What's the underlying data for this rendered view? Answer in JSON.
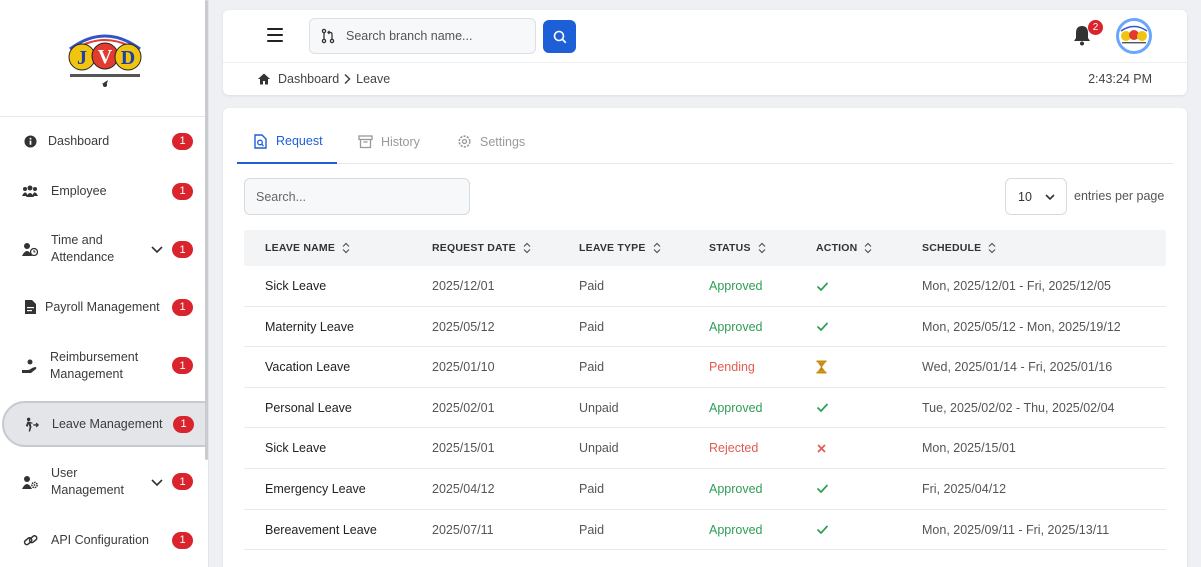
{
  "sidebar": {
    "logo_text": "JVD",
    "items": [
      {
        "label": "Dashboard",
        "badge": "1",
        "icon": "info-circle-icon"
      },
      {
        "label": "Employee",
        "badge": "1",
        "icon": "users-icon"
      },
      {
        "label": "Time and Attendance",
        "badge": "1",
        "icon": "user-clock-icon",
        "expandable": true
      },
      {
        "label": "Payroll Management",
        "badge": "1",
        "icon": "file-invoice-icon"
      },
      {
        "label": "Reimbursement Management",
        "badge": "1",
        "icon": "hand-coin-icon"
      },
      {
        "label": "Leave Management",
        "badge": "1",
        "icon": "person-walking-arrow-icon",
        "active": true
      },
      {
        "label": "User Management",
        "badge": "1",
        "icon": "user-gear-icon",
        "expandable": true
      },
      {
        "label": "API Configuration",
        "badge": "1",
        "icon": "link-icon"
      }
    ]
  },
  "header": {
    "search_placeholder": "Search branch name...",
    "notification_count": "2",
    "breadcrumb": [
      "Dashboard",
      "Leave"
    ],
    "time": "2:43:24 PM"
  },
  "tabs": [
    {
      "label": "Request",
      "active": true,
      "icon": "file-search-icon"
    },
    {
      "label": "History",
      "active": false,
      "icon": "archive-icon"
    },
    {
      "label": "Settings",
      "active": false,
      "icon": "gear-icon"
    }
  ],
  "table": {
    "search_placeholder": "Search...",
    "entries_value": "10",
    "entries_label": "entries per page",
    "columns": [
      "LEAVE NAME",
      "REQUEST DATE",
      "LEAVE TYPE",
      "STATUS",
      "ACTION",
      "SCHEDULE"
    ],
    "rows": [
      {
        "name": "Sick Leave",
        "date": "2025/12/01",
        "type": "Paid",
        "status": "Approved",
        "action": "check",
        "schedule": "Mon, 2025/12/01 - Fri, 2025/12/05"
      },
      {
        "name": "Maternity Leave",
        "date": "2025/05/12",
        "type": "Paid",
        "status": "Approved",
        "action": "check",
        "schedule": "Mon, 2025/05/12 - Mon, 2025/19/12"
      },
      {
        "name": "Vacation Leave",
        "date": "2025/01/10",
        "type": "Paid",
        "status": "Pending",
        "action": "hourglass",
        "schedule": "Wed, 2025/01/14 - Fri, 2025/01/16"
      },
      {
        "name": "Personal Leave",
        "date": "2025/02/01",
        "type": "Unpaid",
        "status": "Approved",
        "action": "check",
        "schedule": "Tue, 2025/02/02 - Thu, 2025/02/04"
      },
      {
        "name": "Sick Leave",
        "date": "2025/15/01",
        "type": "Unpaid",
        "status": "Rejected",
        "action": "cross",
        "schedule": "Mon, 2025/15/01"
      },
      {
        "name": "Emergency Leave",
        "date": "2025/04/12",
        "type": "Paid",
        "status": "Approved",
        "action": "check",
        "schedule": "Fri, 2025/04/12"
      },
      {
        "name": "Bereavement Leave",
        "date": "2025/07/11",
        "type": "Paid",
        "status": "Approved",
        "action": "check",
        "schedule": "Mon, 2025/09/11 - Fri, 2025/13/11"
      }
    ]
  },
  "colors": {
    "accent": "#1d5fd6",
    "badge": "#d9232d",
    "approved": "#2e9e55",
    "pending": "#e25b50",
    "hourglass": "#c98a12"
  }
}
